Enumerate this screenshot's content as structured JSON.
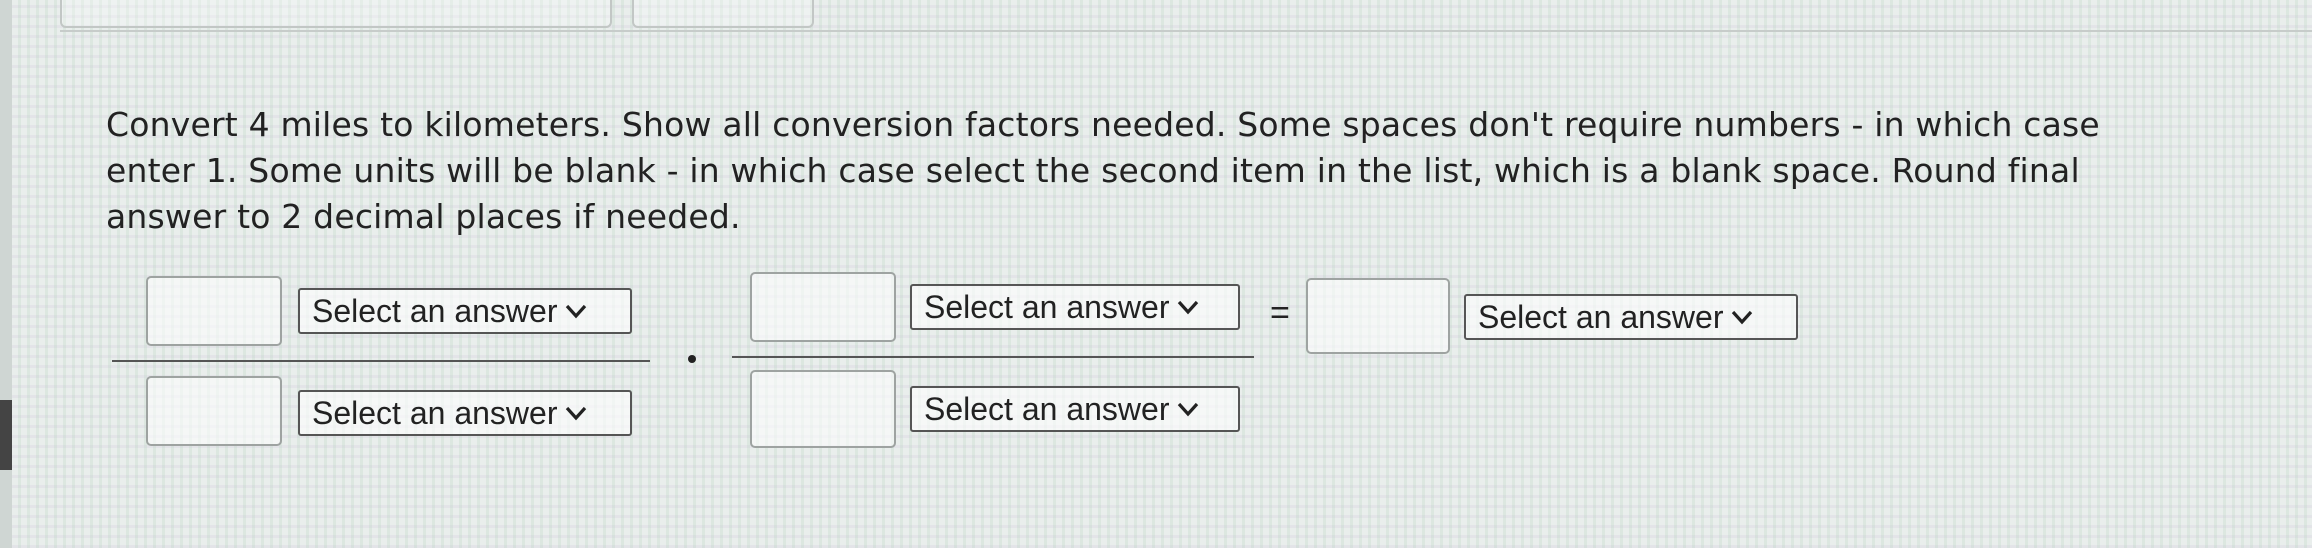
{
  "question": {
    "text": "Convert 4 miles to kilometers. Show all conversion factors needed. Some spaces don't require numbers - in which case enter 1. Some units will be blank - in which case select the second item in the list, which is a blank space. Round final answer to 2 decimal places if needed."
  },
  "operators": {
    "multiply": "·",
    "equals": "="
  },
  "fraction1": {
    "numerator_value": "",
    "numerator_unit": "Select an answer",
    "denominator_value": "",
    "denominator_unit": "Select an answer"
  },
  "fraction2": {
    "numerator_value": "",
    "numerator_unit": "Select an answer",
    "denominator_value": "",
    "denominator_unit": "Select an answer"
  },
  "result": {
    "value": "",
    "unit": "Select an answer"
  },
  "icons": {
    "dropdown": "chevron-down-icon"
  }
}
